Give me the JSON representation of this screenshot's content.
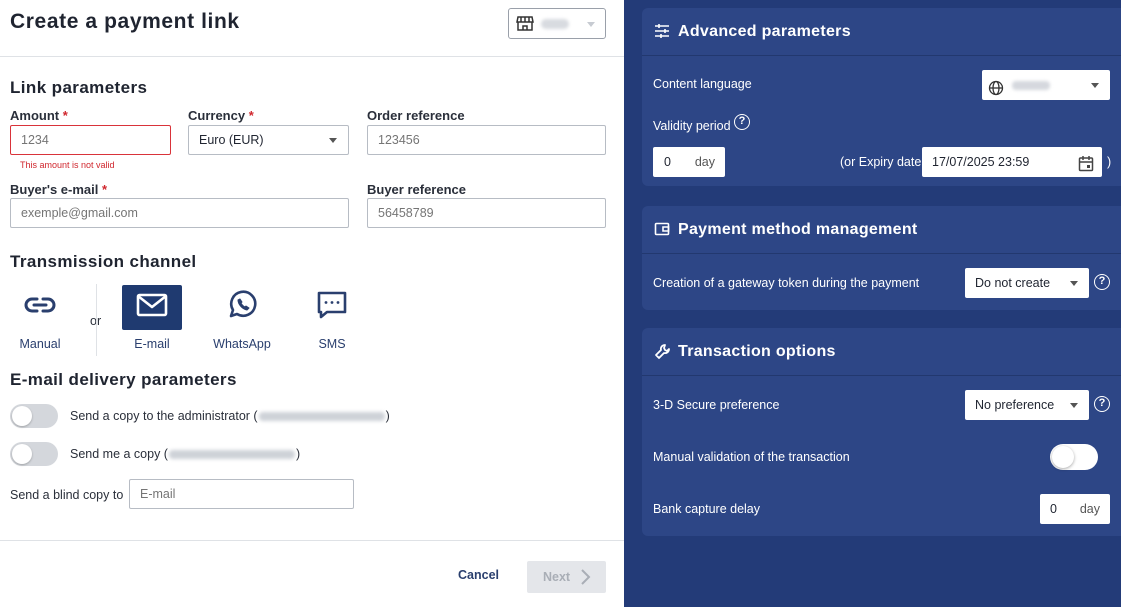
{
  "header": {
    "title": "Create a payment link",
    "shop_select_icon": "store-icon"
  },
  "link_parameters": {
    "title": "Link parameters",
    "amount": {
      "label": "Amount",
      "required_mark": "*",
      "placeholder": "1234",
      "error": "This amount is not valid"
    },
    "currency": {
      "label": "Currency",
      "required_mark": "*",
      "value": "Euro (EUR)"
    },
    "order_reference": {
      "label": "Order reference",
      "placeholder": "123456"
    },
    "buyer_email": {
      "label": "Buyer's e-mail",
      "required_mark": "*",
      "placeholder": "exemple@gmail.com"
    },
    "buyer_reference": {
      "label": "Buyer reference",
      "placeholder": "56458789"
    }
  },
  "transmission": {
    "title": "Transmission channel",
    "or_label": "or",
    "channels": [
      {
        "label": "Manual",
        "icon": "link-icon",
        "active": false
      },
      {
        "label": "E-mail",
        "icon": "envelope-icon",
        "active": true
      },
      {
        "label": "WhatsApp",
        "icon": "whatsapp-icon",
        "active": false
      },
      {
        "label": "SMS",
        "icon": "sms-icon",
        "active": false
      }
    ]
  },
  "email_delivery": {
    "title": "E-mail delivery parameters",
    "copy_admin": {
      "label": "Send a copy to the administrator (",
      "suffix": ")",
      "enabled": false
    },
    "copy_me": {
      "label": "Send me a copy (",
      "suffix": ")",
      "enabled": false
    },
    "blind_copy": {
      "label": "Send a blind copy to",
      "placeholder": "E-mail"
    }
  },
  "footer": {
    "cancel_label": "Cancel",
    "next_label": "Next"
  },
  "advanced": {
    "title": "Advanced parameters",
    "icon": "sliders-icon",
    "content_language_label": "Content language",
    "validity_period_label": "Validity period",
    "validity_value": "0",
    "validity_unit": "day",
    "expiry_prefix": "(or Expiry date",
    "expiry_value": "17/07/2025 23:59",
    "expiry_suffix": ")"
  },
  "payment_method": {
    "title": "Payment method management",
    "icon": "wallet-icon",
    "token_label": "Creation of a gateway token during the payment",
    "token_value": "Do not create"
  },
  "transaction": {
    "title": "Transaction options",
    "icon": "wrench-icon",
    "secure_label": "3-D Secure preference",
    "secure_value": "No preference",
    "manual_validation_label": "Manual validation of the transaction",
    "manual_validation_enabled": false,
    "capture_delay_label": "Bank capture delay",
    "capture_delay_value": "0",
    "capture_delay_unit": "day"
  },
  "colors": {
    "brand_navy": "#233b78",
    "card_bg": "#2d4686",
    "active_tile": "#1f3a70",
    "error_red": "#d0262d"
  }
}
